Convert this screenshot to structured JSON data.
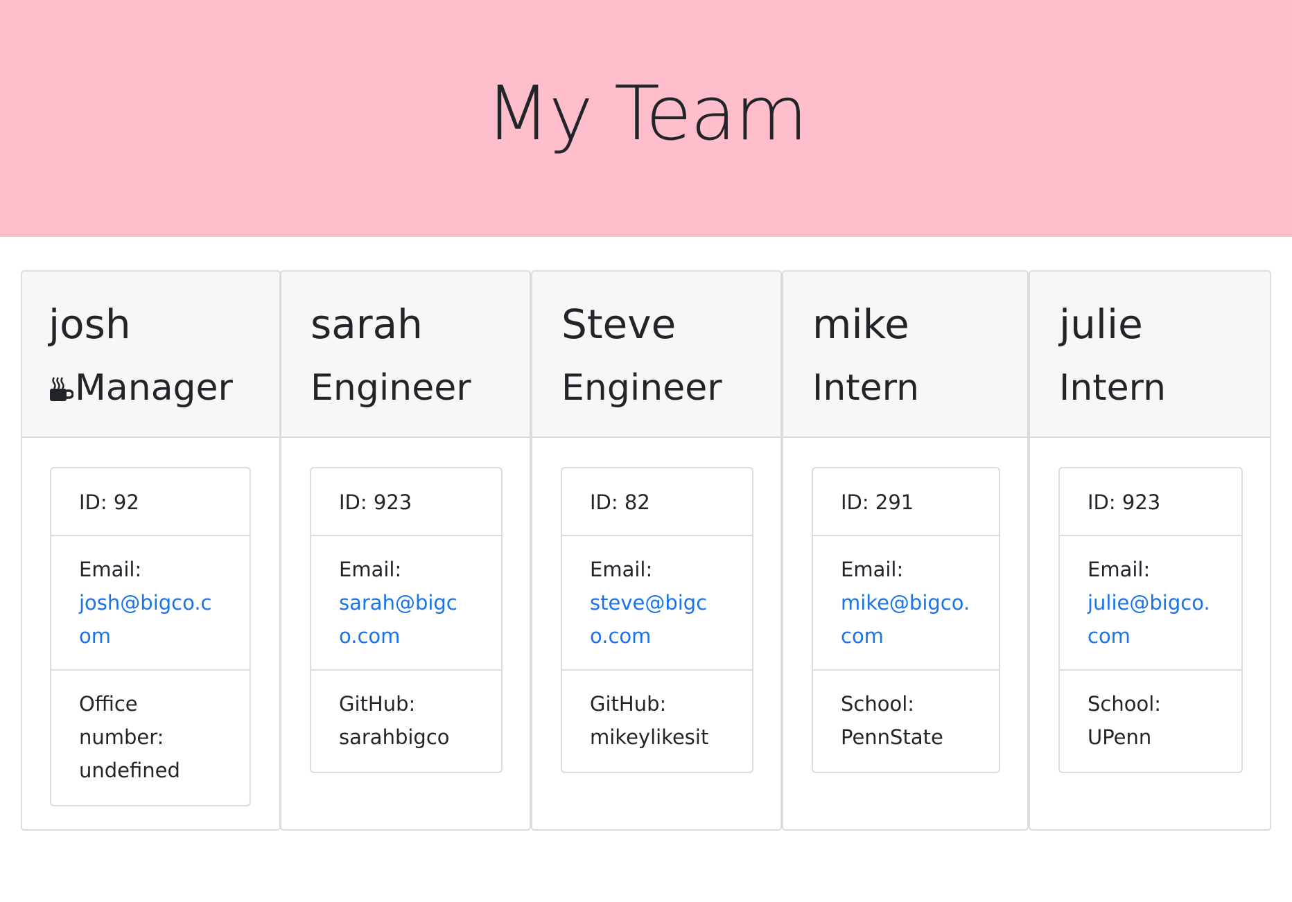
{
  "header": {
    "title": "My Team"
  },
  "employees": [
    {
      "name": "josh",
      "role": "Manager",
      "role_icon": "coffee-mug-icon",
      "id": "ID: 92",
      "email_label": "Email:",
      "email": "josh@bigco.com",
      "extra_label": "Office number:",
      "extra_value": "undefined"
    },
    {
      "name": "sarah",
      "role": "Engineer",
      "id": "ID: 923",
      "email_label": "Email:",
      "email": "sarah@bigco.com",
      "extra_label": "GitHub:",
      "extra_value": "sarahbigco"
    },
    {
      "name": "Steve",
      "role": "Engineer",
      "id": "ID: 82",
      "email_label": "Email:",
      "email": "steve@bigco.com",
      "extra_label": "GitHub:",
      "extra_value": "mikeylikesit"
    },
    {
      "name": "mike",
      "role": "Intern",
      "id": "ID: 291",
      "email_label": "Email:",
      "email": "mike@bigco.com",
      "extra_label": "School:",
      "extra_value": "PennState"
    },
    {
      "name": "julie",
      "role": "Intern",
      "id": "ID: 923",
      "email_label": "Email:",
      "email": "julie@bigco.com",
      "extra_label": "School:",
      "extra_value": "UPenn"
    }
  ],
  "colors": {
    "banner": "#ffbecb",
    "link": "#1a73e8",
    "card_header": "#f7f7f7",
    "border": "#dcdcdc"
  }
}
